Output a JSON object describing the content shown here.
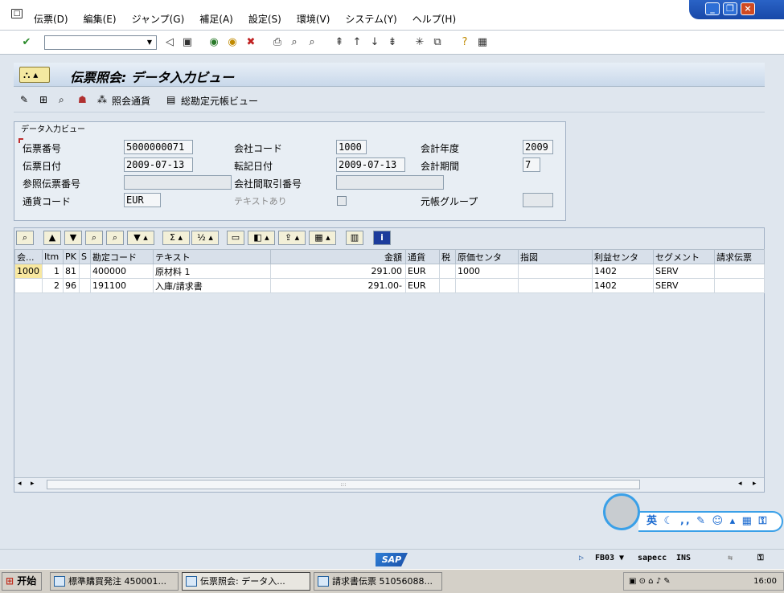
{
  "menubar": {
    "items": [
      "伝票(D)",
      "編集(E)",
      "ジャンプ(G)",
      "補足(A)",
      "設定(S)",
      "環境(V)",
      "システム(Y)",
      "ヘルプ(H)"
    ]
  },
  "title": "伝票照会: データ入力ビュー",
  "app_toolbar": {
    "display_currency": "照会通貨",
    "general_ledger_view": "総勘定元帳ビュー"
  },
  "header_group": {
    "title": "データ入力ビュー",
    "labels": {
      "document_number": "伝票番号",
      "company_code": "会社コード",
      "fiscal_year": "会計年度",
      "document_date": "伝票日付",
      "posting_date": "転記日付",
      "period": "会計期間",
      "reference": "参照伝票番号",
      "intercompany": "会社間取引番号",
      "currency": "通貨コード",
      "text_exists": "テキストあり",
      "ledger_group": "元帳グループ"
    },
    "values": {
      "document_number": "5000000071",
      "company_code": "1000",
      "fiscal_year": "2009",
      "document_date": "2009-07-13",
      "posting_date": "2009-07-13",
      "period": "7",
      "reference": "",
      "intercompany": "",
      "currency": "EUR",
      "ledger_group": ""
    }
  },
  "grid": {
    "columns": [
      "会...",
      "Itm",
      "PK",
      "S",
      "勘定コード",
      "テキスト",
      "金額",
      "通貨",
      "税",
      "原価センタ",
      "指図",
      "利益センタ",
      "セグメント",
      "請求伝票"
    ],
    "rows": [
      {
        "cc": "1000",
        "itm": "1",
        "pk": "81",
        "s": "",
        "account": "400000",
        "text": "原材料 1",
        "amount": "291.00",
        "currency": "EUR",
        "tax": "",
        "cost_center": "1000",
        "order": "",
        "profit_center": "1402",
        "segment": "SERV",
        "billing": ""
      },
      {
        "cc": "",
        "itm": "2",
        "pk": "96",
        "s": "",
        "account": "191100",
        "text": "入庫/請求書",
        "amount": "291.00-",
        "currency": "EUR",
        "tax": "",
        "cost_center": "",
        "order": "",
        "profit_center": "1402",
        "segment": "SERV",
        "billing": ""
      }
    ]
  },
  "statusbar": {
    "tcode": "FB03",
    "server": "sapecc",
    "mode": "INS",
    "logo": "SAP"
  },
  "taskbar": {
    "start": "开始",
    "tasks": [
      "標準購買発注 450001...",
      "伝票照会: データ入...",
      "請求書伝票 51056088..."
    ],
    "clock": "16:00"
  },
  "ime": {
    "label": "英"
  }
}
